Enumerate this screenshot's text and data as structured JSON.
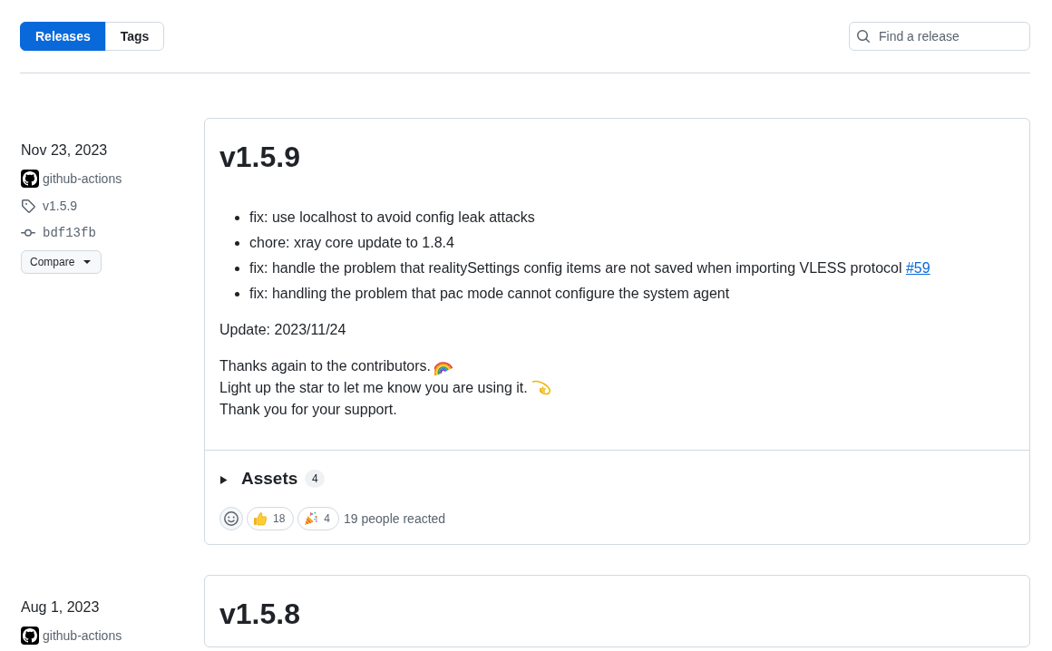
{
  "toolbar": {
    "tabs": [
      {
        "label": "Releases",
        "selected": true
      },
      {
        "label": "Tags",
        "selected": false
      }
    ],
    "search": {
      "placeholder": "Find a release"
    }
  },
  "releases": [
    {
      "date": "Nov 23, 2023",
      "author": "github-actions",
      "tag": "v1.5.9",
      "commit": "bdf13fb",
      "compare_button": "Compare",
      "title": "v1.5.9",
      "changes": [
        {
          "text": "fix: use localhost to avoid config leak attacks"
        },
        {
          "text": "chore: xray core update to 1.8.4"
        },
        {
          "text": "fix: handle the problem that realitySettings config items are not saved when importing VLESS protocol",
          "link": "#59"
        },
        {
          "text": "fix: handling the problem that pac mode cannot configure the system agent"
        }
      ],
      "update_note": "Update: 2023/11/24",
      "closing_lines": [
        {
          "text": "Thanks again to the contributors.",
          "kind": "rainbow"
        },
        {
          "text": "Light up the star to let me know you are using it.",
          "kind": "dizzy"
        },
        {
          "text": "Thank you for your support.",
          "kind": "plain"
        }
      ],
      "assets": {
        "label": "Assets",
        "count": "4",
        "expanded": false
      },
      "reactions": [
        {
          "kind": "thumbs_up",
          "count": "18"
        },
        {
          "kind": "tada",
          "count": "4"
        }
      ],
      "reaction_summary": "19 people reacted"
    },
    {
      "date": "Aug 1, 2023",
      "author": "github-actions",
      "title": "v1.5.8"
    }
  ]
}
